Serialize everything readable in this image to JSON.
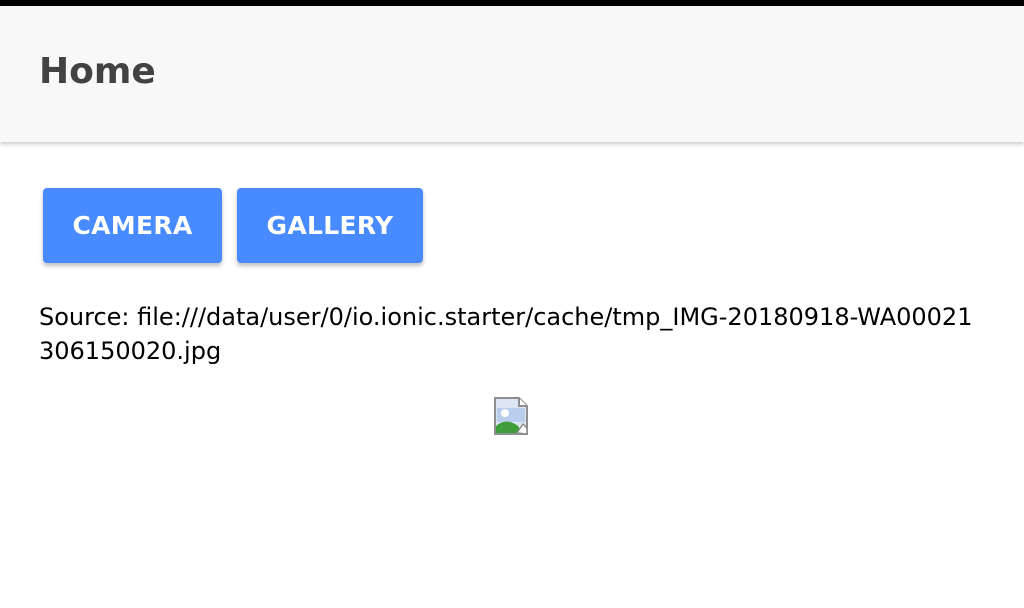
{
  "header": {
    "title": "Home"
  },
  "buttons": {
    "camera_label": "CAMERA",
    "gallery_label": "GALLERY"
  },
  "source": {
    "text": "Source: file:///data/user/0/io.ionic.starter/cache/tmp_IMG-20180918-WA00021306150020.jpg"
  },
  "image": {
    "icon": "broken-image-icon"
  },
  "colors": {
    "primary": "#488aff",
    "toolbar_bg": "#f8f8f8",
    "title_text": "#424242",
    "status_strip": "#000000"
  }
}
